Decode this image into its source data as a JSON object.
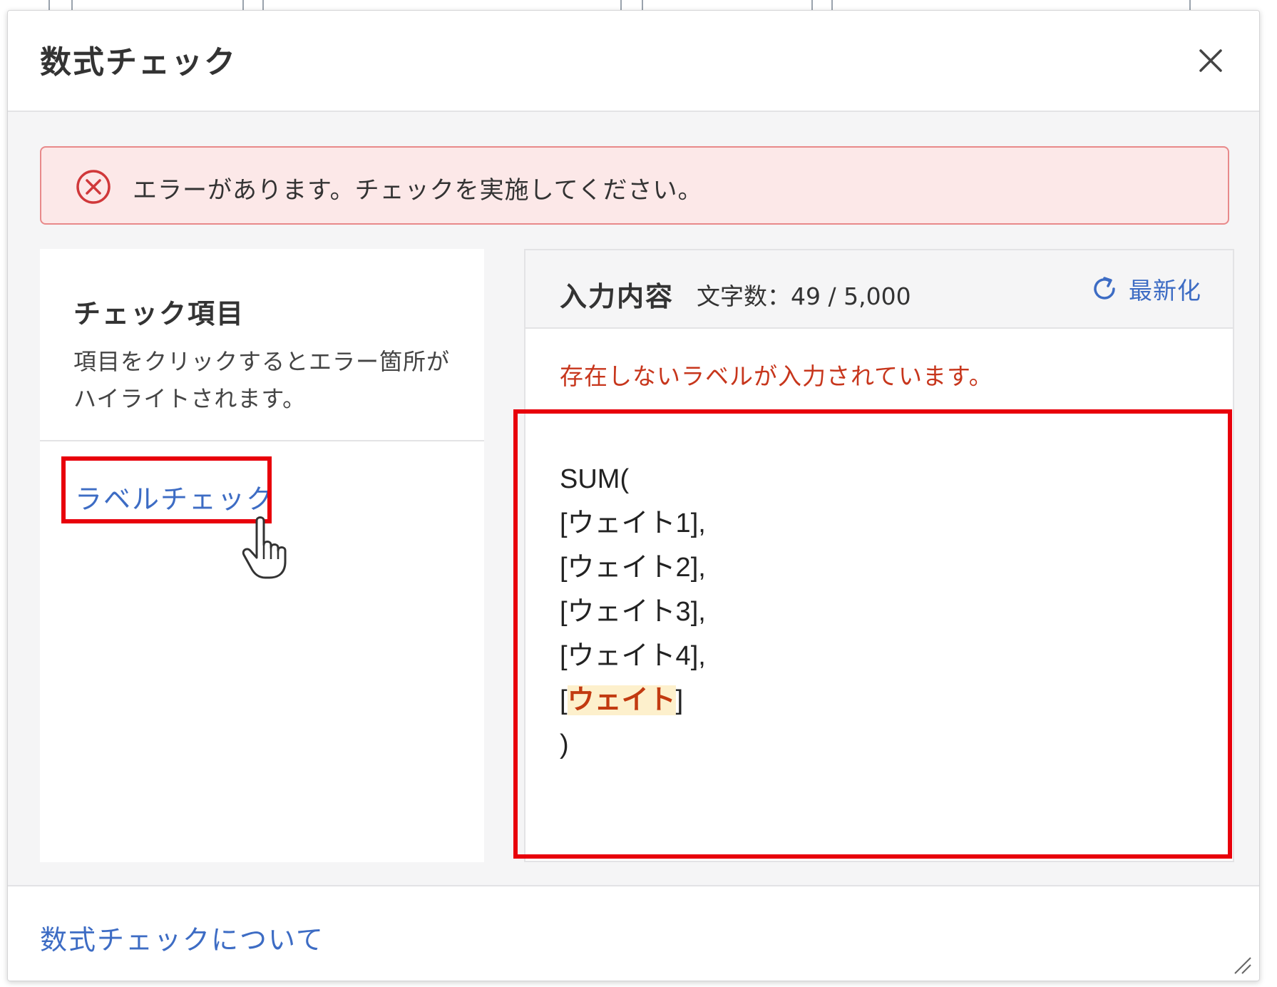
{
  "dialog": {
    "title": "数式チェック",
    "close_icon": "close-icon"
  },
  "error_banner": {
    "icon": "error-circle-x-icon",
    "text": "エラーがあります。チェックを実施してください。",
    "color": "#e8898a"
  },
  "check_items": {
    "title": "チェック項目",
    "description": "項目をクリックするとエラー箇所がハイライトされます。",
    "items": [
      {
        "label": "ラベルチェック"
      }
    ]
  },
  "input_panel": {
    "title": "入力内容",
    "char_count": "文字数：49 / 5,000",
    "refresh_label": "最新化",
    "refresh_icon": "refresh-icon",
    "error_message": "存在しないラベルが入力されています。",
    "formula": {
      "line1": "SUM(",
      "line2": "[ウェイト1],",
      "line3": "[ウェイト2],",
      "line4": "[ウェイト3],",
      "line5": "[ウェイト4],",
      "line6_open": "[",
      "line6_highlight": "ウェイト",
      "line6_close": "]",
      "line7": ")"
    }
  },
  "footer": {
    "about_link": "数式チェックについて"
  },
  "colors": {
    "accent_link": "#3d6cc4",
    "error_text": "#c7361c",
    "annotation_red": "#e8000b",
    "highlight_bg": "#fdf0cc"
  }
}
